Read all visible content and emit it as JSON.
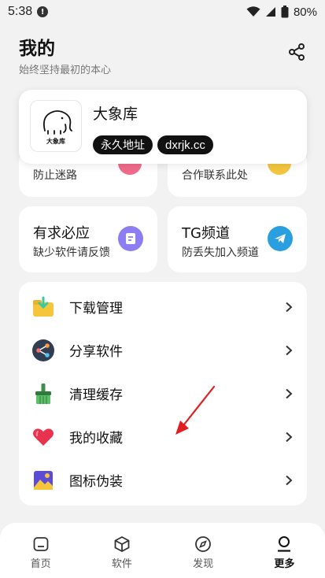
{
  "status_bar": {
    "time": "5:38",
    "alert_glyph": "!",
    "battery_percent": "80%",
    "icons": [
      "wifi-icon",
      "signal-icon",
      "battery-icon"
    ]
  },
  "header": {
    "title": "我的",
    "subtitle": "始终坚持最初的本心",
    "share_icon": "share-icon"
  },
  "profile": {
    "name": "大象库",
    "logo_caption": "大象库",
    "chips": [
      "永久地址",
      "dxrjk.cc"
    ]
  },
  "partial_cards": [
    {
      "subtitle": "防止迷路",
      "icon": "star-badge-icon"
    },
    {
      "subtitle": "合作联系此处",
      "icon": "coin-badge-icon"
    }
  ],
  "feature_cards": [
    {
      "title": "有求必应",
      "subtitle": "缺少软件请反馈",
      "icon": "feedback-icon",
      "color": "#7c6cf0"
    },
    {
      "title": "TG频道",
      "subtitle": "防丢失加入频道",
      "icon": "telegram-icon",
      "color": "#2a9fe0"
    }
  ],
  "menu": [
    {
      "label": "下载管理",
      "icon": "download-folder-icon"
    },
    {
      "label": "分享软件",
      "icon": "share-app-icon"
    },
    {
      "label": "清理缓存",
      "icon": "broom-icon"
    },
    {
      "label": "我的收藏",
      "icon": "heart-icon"
    },
    {
      "label": "图标伪装",
      "icon": "picture-icon"
    }
  ],
  "bottom_nav": [
    {
      "label": "首页",
      "icon": "home-icon",
      "active": false
    },
    {
      "label": "软件",
      "icon": "box-icon",
      "active": false
    },
    {
      "label": "发现",
      "icon": "compass-icon",
      "active": false
    },
    {
      "label": "更多",
      "icon": "person-icon",
      "active": true
    }
  ],
  "colors": {
    "background": "#f2f2f2",
    "card": "#ffffff",
    "annotation_arrow": "#e02020"
  }
}
